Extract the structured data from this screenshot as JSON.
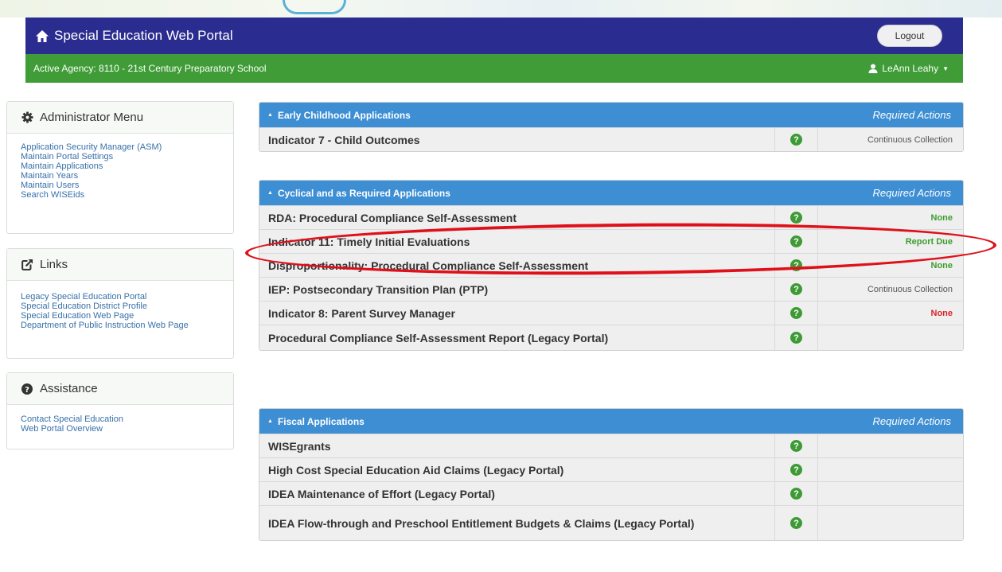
{
  "app": {
    "title": "Special Education Web Portal",
    "logout_label": "Logout"
  },
  "agency": {
    "text": "Active Agency: 8110 - 21st Century Preparatory School",
    "user": "LeAnn Leahy"
  },
  "sidebar": {
    "admin": {
      "title": "Administrator Menu",
      "items": [
        "Application Security Manager (ASM)",
        "Maintain Portal Settings",
        "Maintain Applications",
        "Maintain Years",
        "Maintain Users",
        "Search WISEids"
      ]
    },
    "links": {
      "title": "Links",
      "items": [
        "Legacy Special Education Portal",
        "Special Education District Profile",
        "Special Education Web Page",
        "Department of Public Instruction Web Page"
      ]
    },
    "assistance": {
      "title": "Assistance",
      "items": [
        "Contact Special Education",
        "Web Portal Overview"
      ]
    }
  },
  "panels": [
    {
      "title": "Early Childhood Applications",
      "actions_label": "Required Actions",
      "rows": [
        {
          "name": "Indicator 7 - Child Outcomes",
          "action": "Continuous Collection"
        }
      ]
    },
    {
      "title": "Cyclical and as Required Applications",
      "actions_label": "Required Actions",
      "rows": [
        {
          "name": "RDA: Procedural Compliance Self-Assessment",
          "action": "None"
        },
        {
          "name": "Indicator 11: Timely Initial Evaluations",
          "action": "Report Due"
        },
        {
          "name": "Disproportionality: Procedural Compliance Self-Assessment",
          "action": "None"
        },
        {
          "name": "IEP: Postsecondary Transition Plan (PTP)",
          "action": "Continuous Collection"
        },
        {
          "name": "Indicator 8: Parent Survey Manager",
          "action": "None"
        },
        {
          "name": "Procedural Compliance Self-Assessment Report (Legacy Portal)",
          "action": ""
        }
      ]
    },
    {
      "title": "Fiscal Applications",
      "actions_label": "Required Actions",
      "rows": [
        {
          "name": "WISEgrants",
          "action": ""
        },
        {
          "name": "High Cost Special Education Aid Claims (Legacy Portal)",
          "action": ""
        },
        {
          "name": "IDEA Maintenance of Effort (Legacy Portal)",
          "action": ""
        },
        {
          "name": "IDEA Flow-through and Preschool Entitlement Budgets & Claims (Legacy Portal)",
          "action": ""
        }
      ]
    }
  ],
  "colors": {
    "navbar": "#2b2c8f",
    "agencybar": "#3f9c36",
    "panel_header": "#3d8ed3",
    "status_green": "#3d9c2f",
    "status_red": "#d9242a",
    "highlight": "#e0101a"
  },
  "icons": {
    "home": "home-icon",
    "user": "user-icon",
    "admin": "gear-icon",
    "links": "external-link-icon",
    "assistance": "question-circle-icon",
    "help": "question-circle-icon"
  }
}
